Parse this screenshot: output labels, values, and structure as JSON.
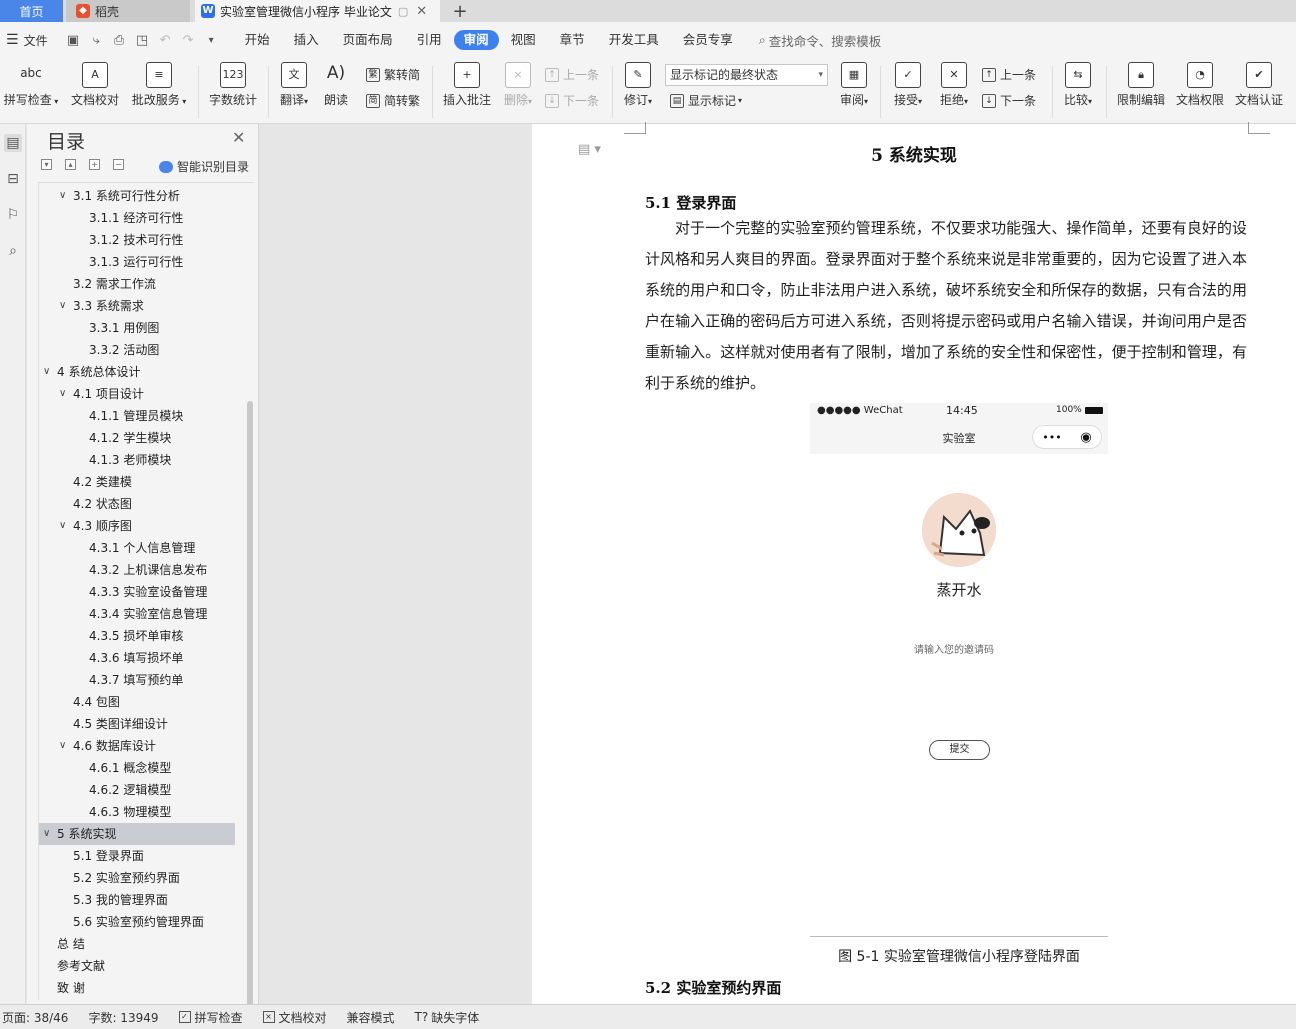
{
  "tabs": {
    "home": "首页",
    "daoke": "稻壳",
    "document": "实验室管理微信小程序 毕业论文",
    "plus": "+"
  },
  "menu": {
    "file": "文件",
    "items": [
      "开始",
      "插入",
      "页面布局",
      "引用",
      "审阅",
      "视图",
      "章节",
      "开发工具",
      "会员专享"
    ],
    "active": "审阅",
    "search": "查找命令、搜索模板"
  },
  "ribbon": {
    "spell_check": "拼写检查",
    "doc_proof": "文档校对",
    "batch_service": "批改服务",
    "word_count": "字数统计",
    "translate": "翻译",
    "read_aloud": "朗读",
    "trad_to_simp": "繁转简",
    "simp_to_trad": "简转繁",
    "insert_comment": "插入批注",
    "delete": "删除",
    "prev_comment": "上一条",
    "next_comment": "下一条",
    "track_changes": "修订",
    "markup_select": "显示标记的最终状态",
    "show_markup": "显示标记",
    "review": "审阅",
    "accept": "接受",
    "reject": "拒绝",
    "prev_change": "上一条",
    "next_change": "下一条",
    "compare": "比较",
    "restrict_edit": "限制编辑",
    "doc_permission": "文档权限",
    "doc_certify": "文档认证"
  },
  "toc": {
    "title": "目录",
    "smart": "智能识别目录",
    "items": [
      {
        "text": "3.1 系统可行性分析",
        "level": 2,
        "arrow": true,
        "selected": false
      },
      {
        "text": "3.1.1 经济可行性",
        "level": 3,
        "arrow": false,
        "selected": false
      },
      {
        "text": "3.1.2 技术可行性",
        "level": 3,
        "arrow": false,
        "selected": false
      },
      {
        "text": "3.1.3 运行可行性",
        "level": 3,
        "arrow": false,
        "selected": false
      },
      {
        "text": "3.2 需求工作流",
        "level": 2,
        "arrow": false,
        "selected": false
      },
      {
        "text": "3.3 系统需求",
        "level": 2,
        "arrow": true,
        "selected": false
      },
      {
        "text": "3.3.1 用例图",
        "level": 3,
        "arrow": false,
        "selected": false
      },
      {
        "text": "3.3.2 活动图",
        "level": 3,
        "arrow": false,
        "selected": false
      },
      {
        "text": "4 系统总体设计",
        "level": 1,
        "arrow": true,
        "selected": false
      },
      {
        "text": "4.1 项目设计",
        "level": 2,
        "arrow": true,
        "selected": false
      },
      {
        "text": "4.1.1 管理员模块",
        "level": 3,
        "arrow": false,
        "selected": false
      },
      {
        "text": "4.1.2 学生模块",
        "level": 3,
        "arrow": false,
        "selected": false
      },
      {
        "text": "4.1.3 老师模块",
        "level": 3,
        "arrow": false,
        "selected": false
      },
      {
        "text": "4.2 类建模",
        "level": 2,
        "arrow": false,
        "selected": false
      },
      {
        "text": "4.2  状态图",
        "level": 2,
        "arrow": false,
        "selected": false
      },
      {
        "text": "4.3  顺序图",
        "level": 2,
        "arrow": true,
        "selected": false
      },
      {
        "text": "4.3.1 个人信息管理",
        "level": 3,
        "arrow": false,
        "selected": false
      },
      {
        "text": "4.3.2 上机课信息发布",
        "level": 3,
        "arrow": false,
        "selected": false
      },
      {
        "text": "4.3.3 实验室设备管理",
        "level": 3,
        "arrow": false,
        "selected": false
      },
      {
        "text": "4.3.4 实验室信息管理",
        "level": 3,
        "arrow": false,
        "selected": false
      },
      {
        "text": "4.3.5 损坏单审核",
        "level": 3,
        "arrow": false,
        "selected": false
      },
      {
        "text": "4.3.6 填写损坏单",
        "level": 3,
        "arrow": false,
        "selected": false
      },
      {
        "text": "4.3.7 填写预约单",
        "level": 3,
        "arrow": false,
        "selected": false
      },
      {
        "text": "4.4  包图",
        "level": 2,
        "arrow": false,
        "selected": false
      },
      {
        "text": "4.5 类图详细设计",
        "level": 2,
        "arrow": false,
        "selected": false
      },
      {
        "text": "4.6  数据库设计",
        "level": 2,
        "arrow": true,
        "selected": false
      },
      {
        "text": "4.6.1  概念模型",
        "level": 3,
        "arrow": false,
        "selected": false
      },
      {
        "text": "4.6.2  逻辑模型",
        "level": 3,
        "arrow": false,
        "selected": false
      },
      {
        "text": "4.6.3  物理模型",
        "level": 3,
        "arrow": false,
        "selected": false
      },
      {
        "text": "5 系统实现",
        "level": 1,
        "arrow": true,
        "selected": true
      },
      {
        "text": "5.1 登录界面",
        "level": 2,
        "arrow": false,
        "selected": false
      },
      {
        "text": "5.2  实验室预约界面",
        "level": 2,
        "arrow": false,
        "selected": false
      },
      {
        "text": "5.3  我的管理界面",
        "level": 2,
        "arrow": false,
        "selected": false
      },
      {
        "text": "5.6  实验室预约管理界面",
        "level": 2,
        "arrow": false,
        "selected": false
      },
      {
        "text": "总    结",
        "level": 1,
        "arrow": false,
        "selected": false
      },
      {
        "text": "参考文献",
        "level": 1,
        "arrow": false,
        "selected": false
      },
      {
        "text": "致    谢",
        "level": 1,
        "arrow": false,
        "selected": false
      }
    ]
  },
  "document": {
    "heading1": "5 系统实现",
    "heading2_a": "5.1 登录界面",
    "paragraph": "对于一个完整的实验室预约管理系统，不仅要求功能强大、操作简单，还要有良好的设计风格和另人爽目的界面。登录界面对于整个系统来说是非常重要的，因为它设置了进入本系统的用户和口令，防止非法用户进入系统，破坏系统安全和所保存的数据，只有合法的用户在输入正确的密码后方可进入系统，否则将提示密码或用户名输入错误，并询问用户是否重新输入。这样就对使用者有了限制，增加了系统的安全性和保密性，便于控制和管理，有利于系统的维护。",
    "figure_caption": "图 5-1  实验室管理微信小程序登陆界面",
    "heading2_b": "5.2  实验室预约界面"
  },
  "phone": {
    "carrier": "●●●●● WeChat",
    "time": "14:45",
    "battery": "100%",
    "title": "实验室",
    "more": "•••",
    "nickname": "蒸开水",
    "invite_placeholder": "请输入您的邀请码",
    "submit": "提交"
  },
  "statusbar": {
    "page": "页面: 38/46",
    "words": "字数: 13949",
    "spell": "拼写检查",
    "proof": "文档校对",
    "compat": "兼容模式",
    "missing_font": "缺失字体"
  },
  "colors": {
    "accent": "#3d80f0",
    "home_tab": "#4a86e8"
  }
}
